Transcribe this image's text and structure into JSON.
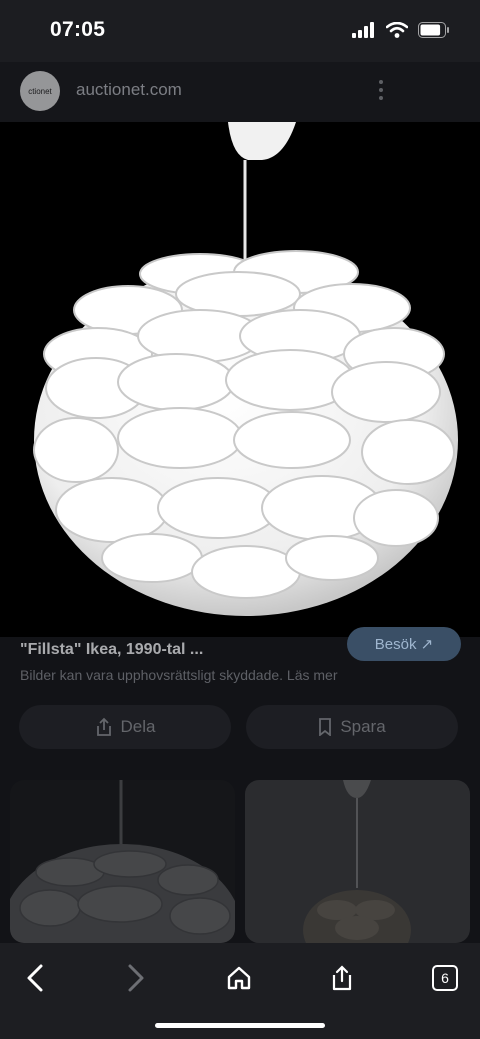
{
  "status_bar": {
    "time": "07:05",
    "battery_level": 0.85
  },
  "site": {
    "avatar_text": "ctionet",
    "domain": "auctionet.com"
  },
  "result": {
    "title": "\"Fillsta\" Ikea, 1990-tal ...",
    "copyright_note": "Bilder kan vara upphovsrättsligt skyddade. Läs mer",
    "visit_label": "Besök ↗"
  },
  "actions": {
    "share_label": "Dela",
    "save_label": "Spara"
  },
  "browser": {
    "tab_count": "6"
  },
  "colors": {
    "background": "#000000",
    "panel": "#121317",
    "toolbar": "#1d1e22",
    "accent": "#3a4f66"
  },
  "icons": {
    "status": [
      "signal-icon",
      "wifi-icon",
      "battery-icon"
    ],
    "header": [
      "site-avatar",
      "more-options-icon"
    ],
    "actions": [
      "share-icon",
      "bookmark-icon"
    ],
    "toolbar": [
      "back-icon",
      "forward-icon",
      "home-icon",
      "share-icon",
      "tabs-icon"
    ]
  }
}
